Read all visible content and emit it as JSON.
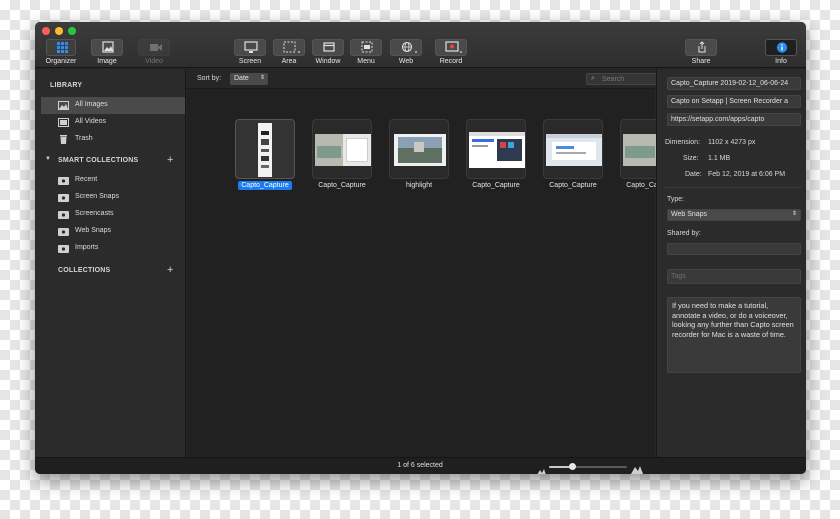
{
  "toolbar": {
    "organizer": "Organizer",
    "image": "Image",
    "video": "Video",
    "screen": "Screen",
    "area": "Area",
    "window": "Window",
    "menu": "Menu",
    "web": "Web",
    "record": "Record",
    "share": "Share",
    "info": "Info"
  },
  "sidebar": {
    "library_header": "LIBRARY",
    "library_items": [
      {
        "label": "All Images"
      },
      {
        "label": "All Videos"
      },
      {
        "label": "Trash"
      }
    ],
    "smart_header": "SMART COLLECTIONS",
    "smart_items": [
      {
        "label": "Recent"
      },
      {
        "label": "Screen Snaps"
      },
      {
        "label": "Screencasts"
      },
      {
        "label": "Web Snaps"
      },
      {
        "label": "Imports"
      }
    ],
    "collections_header": "COLLECTIONS"
  },
  "browser": {
    "sort_label": "Sort by:",
    "sort_value": "Date",
    "search_placeholder": "Search",
    "items": [
      {
        "label": "Capto_Capture",
        "selected": true
      },
      {
        "label": "Capto_Capture"
      },
      {
        "label": "highlight"
      },
      {
        "label": "Capto_Capture"
      },
      {
        "label": "Capto_Capture"
      },
      {
        "label": "Capto_Capture"
      }
    ]
  },
  "inspector": {
    "name_value": "Capto_Capture 2019-02-12_06-06-24",
    "title_value": "Capto on Setapp | Screen Recorder a",
    "url_value": "https://setapp.com/apps/capto",
    "dimension_label": "Dimension:",
    "dimension_value": "1102 x 4273 px",
    "size_label": "Size:",
    "size_value": "1.1 MB",
    "date_label": "Date:",
    "date_value": "Feb 12, 2019 at 6:06 PM",
    "type_label": "Type:",
    "type_value": "Web Snaps",
    "shared_label": "Shared by:",
    "tags_placeholder": "Tags",
    "notes": "If you need to make a tutorial, annotate a video, or do a voiceover, looking any further than Capto screen recorder for Mac is a waste of time."
  },
  "status": {
    "selection_text": "1 of 6 selected",
    "zoom_level": 0.3
  },
  "colors": {
    "accent": "#1a7cf0",
    "info_blue": "#2a8cf0",
    "close": "#fc5f57",
    "minimize": "#fdbc2e",
    "zoom": "#27c840"
  }
}
